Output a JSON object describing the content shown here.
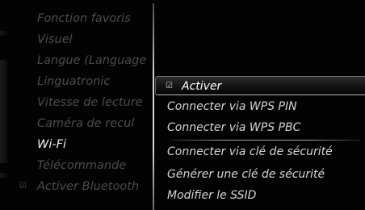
{
  "left_menu": {
    "items": [
      {
        "label": "Fonction favoris",
        "state": "inactive"
      },
      {
        "label": "Visuel",
        "state": "inactive"
      },
      {
        "label": "Langue (Language",
        "state": "inactive"
      },
      {
        "label": "Linguatronic",
        "state": "inactive"
      },
      {
        "label": "Vitesse de lecture",
        "state": "inactive"
      },
      {
        "label": "Caméra de recul",
        "state": "inactive"
      },
      {
        "label": "Wi-Fi",
        "state": "active"
      },
      {
        "label": "Télécommande",
        "state": "inactive"
      },
      {
        "label": "Activer Bluetooth",
        "state": "inactive",
        "checked": true
      }
    ]
  },
  "submenu": {
    "items": [
      {
        "label": "Activer",
        "selected": true,
        "checked": true
      },
      {
        "label": "Connecter via WPS PIN"
      },
      {
        "label": "Connecter via WPS PBC"
      },
      {
        "label": "Connecter via clé de sécurité"
      },
      {
        "label": "Générer une clé de sécurité"
      },
      {
        "label": "Modifier le SSID"
      }
    ]
  },
  "colors": {
    "background": "#030303",
    "active_text": "#ececec",
    "inactive_text": "#4c4c4c",
    "submenu_text": "#d4d4d4"
  },
  "icons": {
    "checked_marker": "checkbox-icon"
  }
}
